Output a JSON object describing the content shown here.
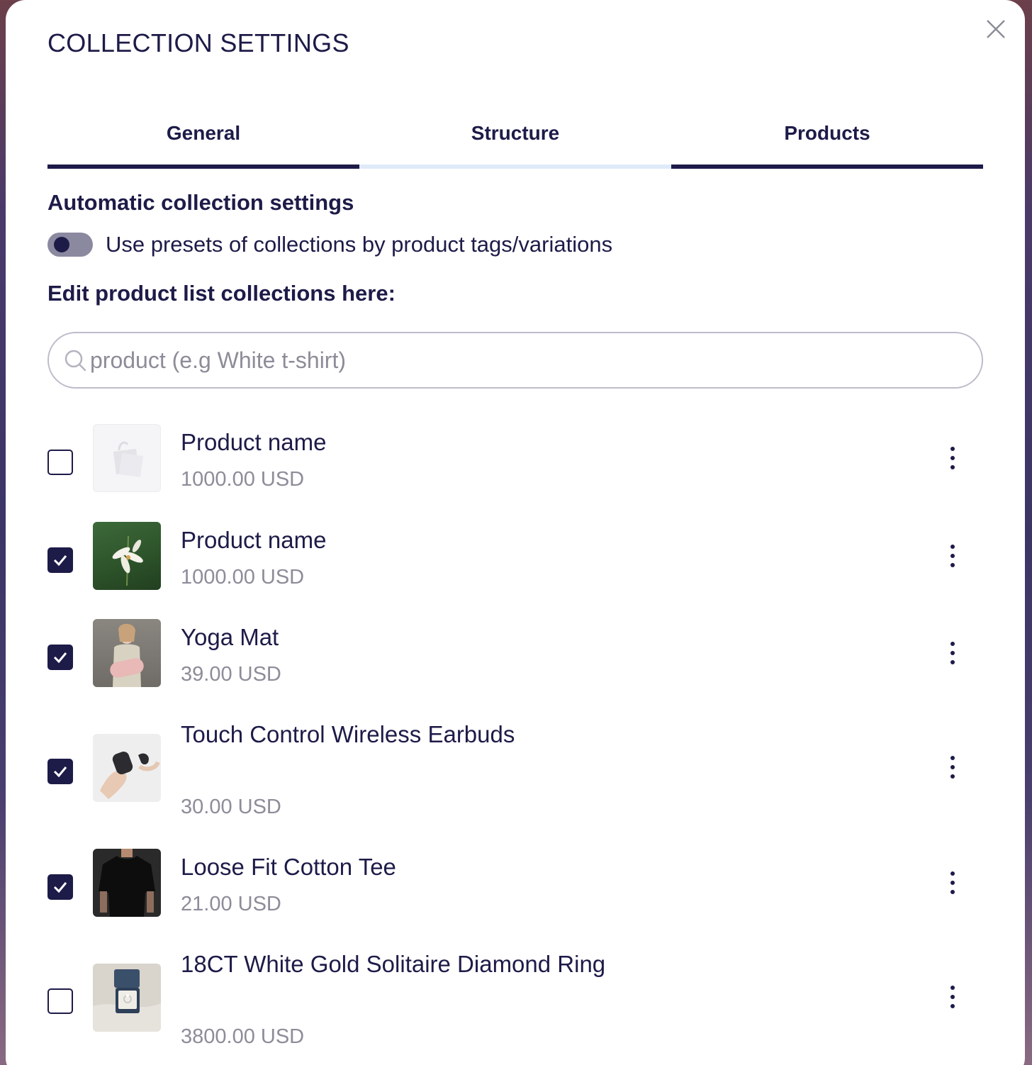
{
  "dialog": {
    "title": "COLLECTION SETTINGS"
  },
  "tabs": [
    {
      "label": "General",
      "active": true
    },
    {
      "label": "Structure",
      "active": false
    },
    {
      "label": "Products",
      "active": true
    }
  ],
  "automatic": {
    "heading": "Automatic collection settings",
    "toggle_label": "Use presets of collections by product tags/variations",
    "toggle_on": false
  },
  "edit": {
    "heading": "Edit product list collections here:"
  },
  "search": {
    "placeholder": "product (e.g White t-shirt)",
    "value": ""
  },
  "products": [
    {
      "name": "Product name",
      "price": "1000.00 USD",
      "checked": false,
      "thumb": "shopping-bag-icon"
    },
    {
      "name": "Product name",
      "price": "1000.00 USD",
      "checked": true,
      "thumb": "lily-flower-image"
    },
    {
      "name": "Yoga Mat",
      "price": "39.00 USD",
      "checked": true,
      "thumb": "yoga-mat-image"
    },
    {
      "name": "Touch Control Wireless Earbuds",
      "price": "30.00 USD",
      "checked": true,
      "thumb": "earbuds-image"
    },
    {
      "name": "Loose Fit Cotton Tee",
      "price": "21.00 USD",
      "checked": true,
      "thumb": "black-tee-image"
    },
    {
      "name": "18CT White Gold Solitaire Diamond Ring",
      "price": "3800.00 USD",
      "checked": false,
      "thumb": "ring-box-image"
    }
  ],
  "colors": {
    "primary": "#1d1b48",
    "muted": "#8d8c99",
    "tab_inactive_underline": "#dfeaf8"
  }
}
